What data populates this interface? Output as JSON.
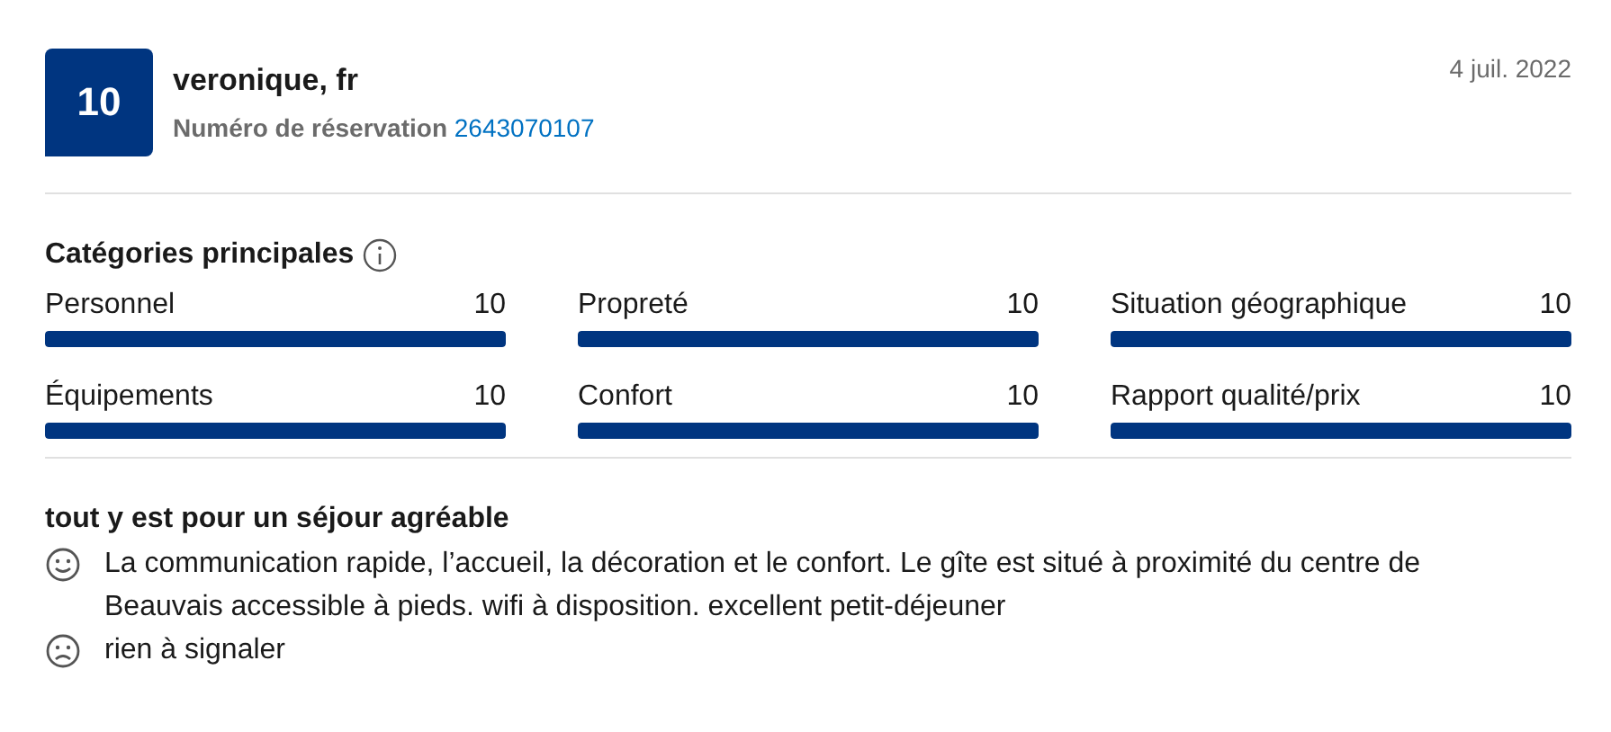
{
  "review": {
    "score": "10",
    "reviewer": "veronique, fr",
    "booking_label": "Numéro de réservation",
    "booking_number": "2643070107",
    "date": "4 juil. 2022"
  },
  "categories": {
    "title": "Catégories principales",
    "items": [
      {
        "label": "Personnel",
        "score": "10",
        "level": 1
      },
      {
        "label": "Propreté",
        "score": "10",
        "level": 1
      },
      {
        "label": "Situation géographique",
        "score": "10",
        "level": 1
      },
      {
        "label": "Équipements",
        "score": "10",
        "level": 1
      },
      {
        "label": "Confort",
        "score": "10",
        "level": 1
      },
      {
        "label": "Rapport qualité/prix",
        "score": "10",
        "level": 1
      }
    ]
  },
  "comment": {
    "title": "tout y est pour un séjour agréable",
    "lines": [
      {
        "kind": "positive",
        "text": "La communication rapide, l’accueil, la décoration et le confort. Le gîte est situé à proximité du centre de Beauvais accessible à pieds. wifi à disposition. excellent petit-déjeuner"
      },
      {
        "kind": "negative",
        "text": "rien à signaler"
      }
    ]
  }
}
